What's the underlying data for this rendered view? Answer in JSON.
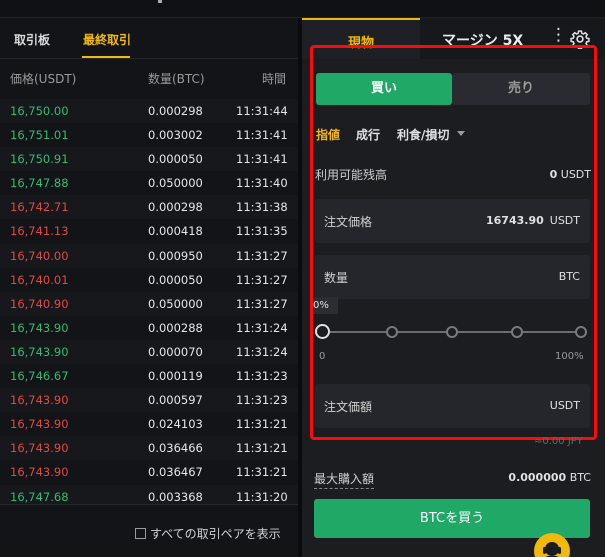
{
  "left_panel": {
    "tabs": [
      {
        "label": "取引板",
        "active": false
      },
      {
        "label": "最終取引",
        "active": true
      }
    ],
    "columns": {
      "price": "価格(USDT)",
      "qty": "数量(BTC)",
      "time": "時間"
    },
    "trades": [
      {
        "price": "16,750.00",
        "qty": "0.000298",
        "time": "11:31:44",
        "dir": "up"
      },
      {
        "price": "16,751.01",
        "qty": "0.003002",
        "time": "11:31:41",
        "dir": "up"
      },
      {
        "price": "16,750.91",
        "qty": "0.000050",
        "time": "11:31:41",
        "dir": "up"
      },
      {
        "price": "16,747.88",
        "qty": "0.050000",
        "time": "11:31:40",
        "dir": "up"
      },
      {
        "price": "16,742.71",
        "qty": "0.000298",
        "time": "11:31:38",
        "dir": "down"
      },
      {
        "price": "16,741.13",
        "qty": "0.000418",
        "time": "11:31:35",
        "dir": "down"
      },
      {
        "price": "16,740.00",
        "qty": "0.000950",
        "time": "11:31:27",
        "dir": "down"
      },
      {
        "price": "16,740.01",
        "qty": "0.000050",
        "time": "11:31:27",
        "dir": "down"
      },
      {
        "price": "16,740.90",
        "qty": "0.050000",
        "time": "11:31:27",
        "dir": "down"
      },
      {
        "price": "16,743.90",
        "qty": "0.000288",
        "time": "11:31:24",
        "dir": "up"
      },
      {
        "price": "16,743.90",
        "qty": "0.000070",
        "time": "11:31:24",
        "dir": "up"
      },
      {
        "price": "16,746.67",
        "qty": "0.000119",
        "time": "11:31:23",
        "dir": "up"
      },
      {
        "price": "16,743.90",
        "qty": "0.000597",
        "time": "11:31:23",
        "dir": "down"
      },
      {
        "price": "16,743.90",
        "qty": "0.024103",
        "time": "11:31:21",
        "dir": "down"
      },
      {
        "price": "16,743.90",
        "qty": "0.036466",
        "time": "11:31:21",
        "dir": "down"
      },
      {
        "price": "16,743.90",
        "qty": "0.036467",
        "time": "11:31:21",
        "dir": "down"
      },
      {
        "price": "16,747.68",
        "qty": "0.003368",
        "time": "11:31:20",
        "dir": "up"
      }
    ],
    "show_all_pairs_label": "すべての取引ペアを表示"
  },
  "right_panel": {
    "tabs": {
      "spot": "現物",
      "margin": "マージン 5X"
    },
    "buy_label": "買い",
    "sell_label": "売り",
    "order_types": [
      "指値",
      "成行",
      "利食/損切"
    ],
    "available": {
      "label": "利用可能残高",
      "value": "0",
      "unit": "USDT"
    },
    "price_field": {
      "label": "注文価格",
      "value": "16743.90",
      "unit": "USDT"
    },
    "qty_field": {
      "label": "数量",
      "unit": "BTC"
    },
    "slider": {
      "tip": "0%",
      "min": "0",
      "max": "100%",
      "value_percent": 0,
      "stops": [
        0,
        25,
        50,
        75,
        100
      ]
    },
    "total_field": {
      "label": "注文価額",
      "unit": "USDT"
    },
    "jpy_hint": "≈0.00 JPY",
    "max_buy": {
      "label": "最大購入額",
      "value": "0.000000",
      "unit": "BTC"
    },
    "buy_button": "BTCを買う"
  },
  "colors": {
    "up": "#2fbd71",
    "down": "#e04848",
    "accent": "#f0b90b",
    "buy": "#1fa866",
    "highlight": "#ff0a0a"
  }
}
